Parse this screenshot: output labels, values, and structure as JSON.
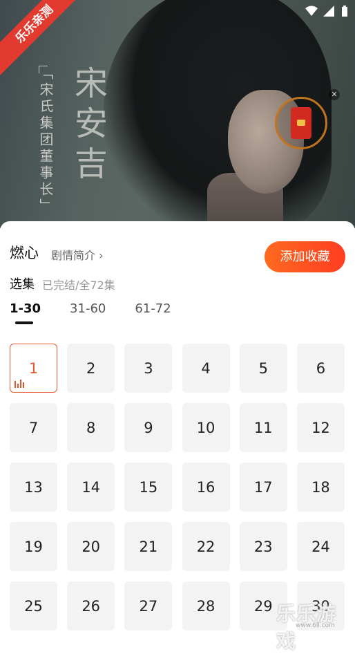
{
  "watermark_ribbon": "乐乐亲测",
  "poster": {
    "subtitle": "「宋氏集团董事长」",
    "name": "宋安吉"
  },
  "drama": {
    "title": "燃心",
    "synopsis_link": "剧情简介",
    "collect_button": "添加收藏"
  },
  "selection": {
    "label": "选集",
    "status": "已完结/全72集"
  },
  "tabs": [
    {
      "label": "1-30",
      "active": true
    },
    {
      "label": "31-60",
      "active": false
    },
    {
      "label": "61-72",
      "active": false
    }
  ],
  "episodes": [
    "1",
    "2",
    "3",
    "4",
    "5",
    "6",
    "7",
    "8",
    "9",
    "10",
    "11",
    "12",
    "13",
    "14",
    "15",
    "16",
    "17",
    "18",
    "19",
    "20",
    "21",
    "22",
    "23",
    "24",
    "25",
    "26",
    "27",
    "28",
    "29",
    "30"
  ],
  "active_episode": "1",
  "watermark_logo": "乐乐游戏",
  "watermark_url": "www.6ll.com",
  "colors": {
    "accent": "#e4572e",
    "button_start": "#ff6a1f",
    "button_end": "#ff3d22"
  }
}
